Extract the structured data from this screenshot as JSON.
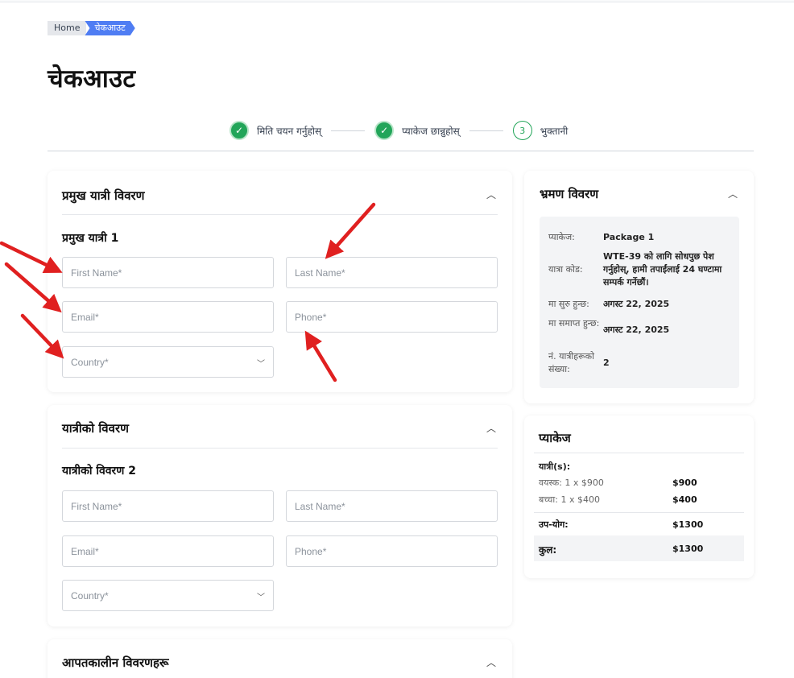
{
  "breadcrumb": {
    "home": "Home",
    "current": "चेकआउट"
  },
  "page_title": "चेकआउट",
  "stepper": {
    "steps": [
      {
        "label": "मिति चयन गर्नुहोस्",
        "state": "done",
        "icon": "check-icon"
      },
      {
        "label": "प्याकेज छान्नुहोस्",
        "state": "done",
        "icon": "check-icon"
      },
      {
        "label": "भुक्तानी",
        "state": "current",
        "number": "3"
      }
    ]
  },
  "lead_traveler": {
    "title": "प्रमुख यात्री विवरण",
    "subtitle": "प्रमुख यात्री 1",
    "first_name_placeholder": "First Name*",
    "last_name_placeholder": "Last Name*",
    "email_placeholder": "Email*",
    "phone_placeholder": "Phone*",
    "country_placeholder": "Country*"
  },
  "traveler_details": {
    "title": "यात्रीको विवरण",
    "subtitle": "यात्रीको विवरण 2",
    "first_name_placeholder": "First Name*",
    "last_name_placeholder": "Last Name*",
    "email_placeholder": "Email*",
    "phone_placeholder": "Phone*",
    "country_placeholder": "Country*"
  },
  "emergency": {
    "title": "आपतकालीन विवरणहरू"
  },
  "trip_details": {
    "title": "भ्रमण विवरण",
    "rows": [
      {
        "key": "प्याकेज:",
        "value": "Package 1"
      },
      {
        "key": "यात्रा कोड:",
        "value": "WTE-39 को लागि सोधपुछ पेश गर्नुहोस्, हामी तपाईंलाई 24 घण्टामा सम्पर्क गर्नेछौं।"
      },
      {
        "key": "मा सुरु हुन्छ:",
        "value": "अगस्ट 22, 2025"
      },
      {
        "key": "मा समाप्त हुन्छ:",
        "value": "अगस्ट 22, 2025"
      },
      {
        "key": "नं. यात्रीहरूको संख्या:",
        "value": "2"
      }
    ]
  },
  "package": {
    "title": "प्याकेज",
    "travelers_label": "यात्री(s):",
    "adult_label": "वयस्क: 1 x $900",
    "adult_amount": "$900",
    "child_label": "बच्चा: 1 x $400",
    "child_amount": "$400",
    "subtotal_label": "उप-योग:",
    "subtotal_amount": "$1300",
    "total_label": "कुल:",
    "total_amount": "$1300"
  },
  "colors": {
    "accent": "#4f7df3",
    "success": "#22a559",
    "arrow": "#e02020"
  }
}
